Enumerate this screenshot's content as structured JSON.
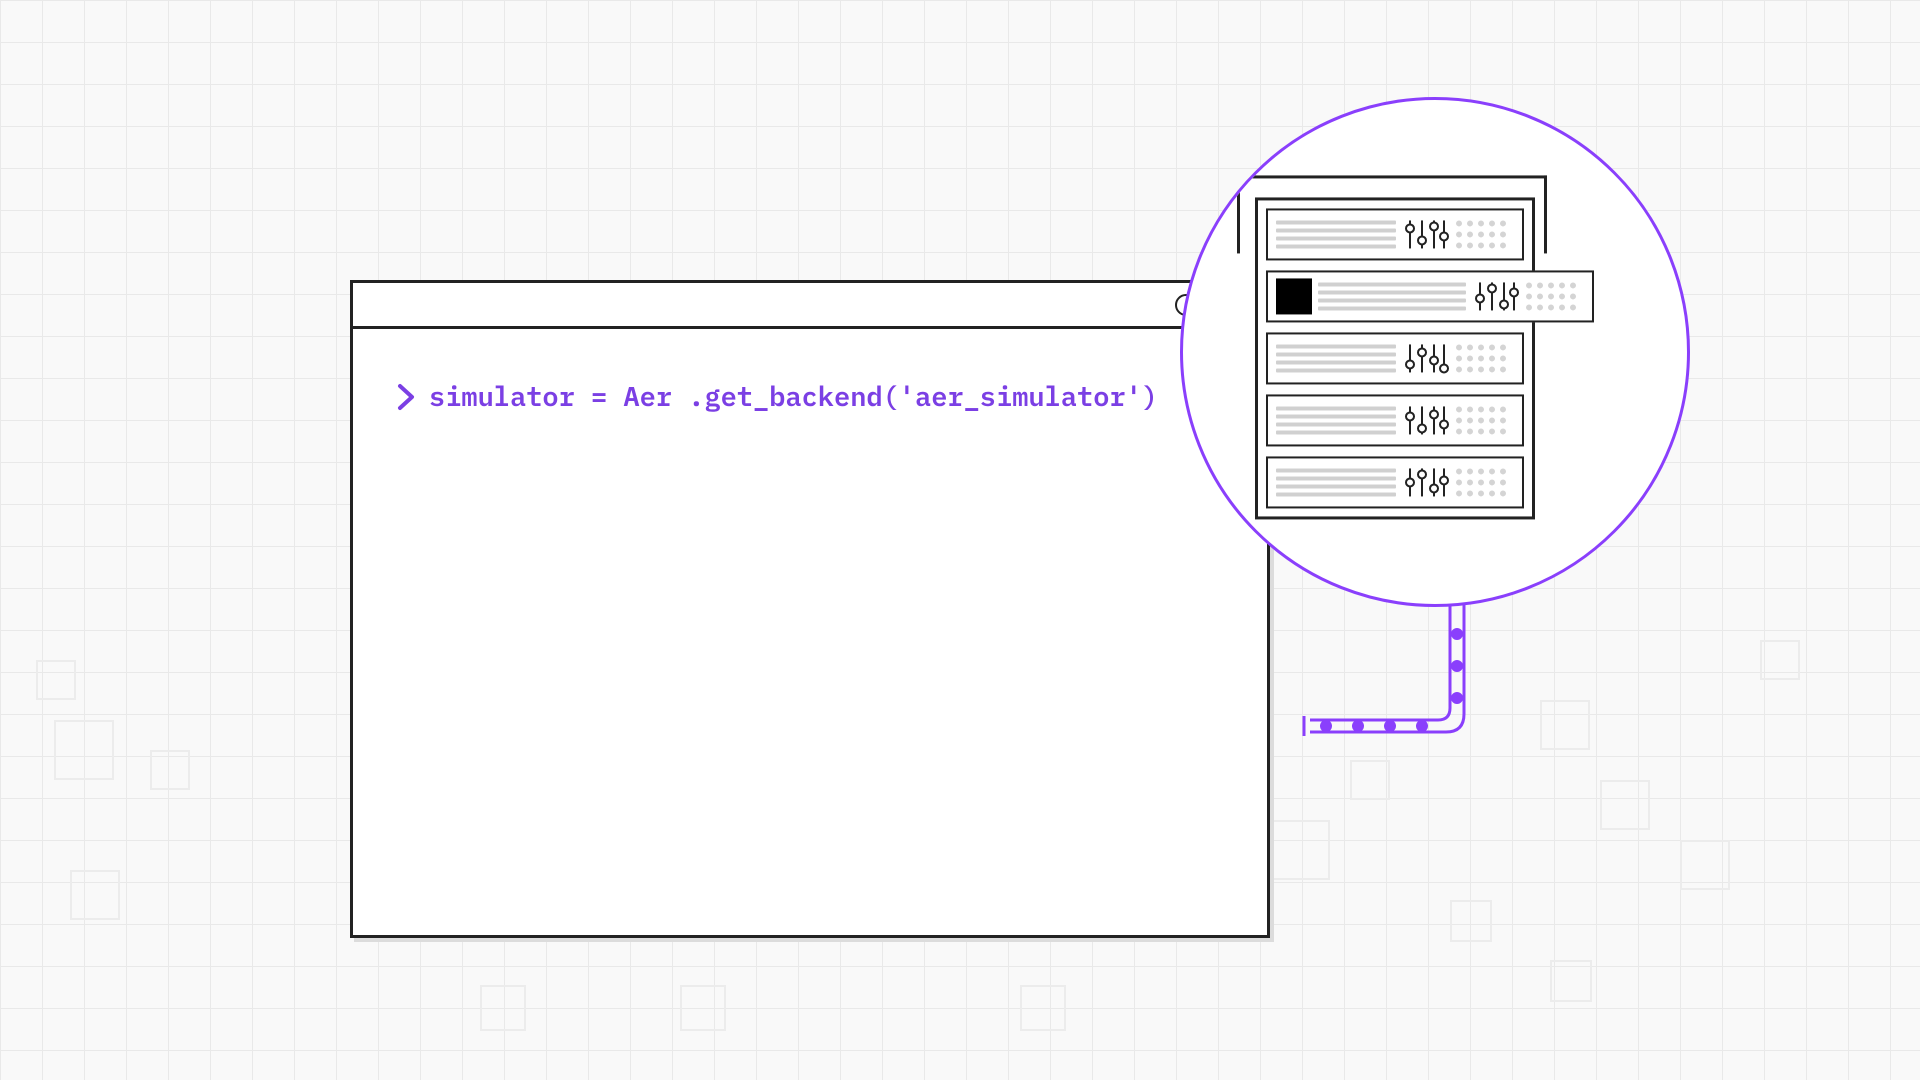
{
  "terminal": {
    "code_line": "simulator = Aer .get_backend('aer_simulator')"
  },
  "colors": {
    "accent": "#8a3ffc",
    "code": "#7b3fe4",
    "stroke": "#222222"
  },
  "magnifier": {
    "rack_count": 5,
    "selected_index": 1
  }
}
